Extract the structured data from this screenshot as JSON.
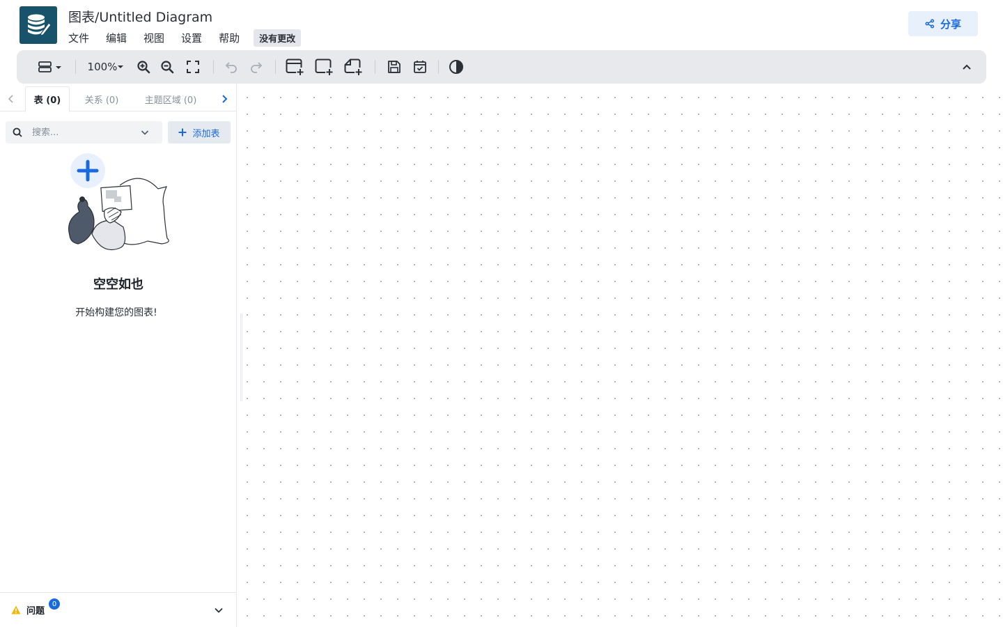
{
  "app": {
    "title": "图表/Untitled Diagram",
    "status": "没有更改",
    "share_label": "分享"
  },
  "menu": {
    "items": [
      "文件",
      "编辑",
      "视图",
      "设置",
      "帮助"
    ]
  },
  "toolbar": {
    "zoom": "100%",
    "icons": [
      "layout-icon",
      "zoom-in-icon",
      "zoom-out-icon",
      "fit-screen-icon",
      "undo-icon",
      "redo-icon",
      "add-table-icon",
      "add-area-icon",
      "add-note-icon",
      "save-icon",
      "todo-icon",
      "theme-icon",
      "collapse-icon"
    ]
  },
  "sidebar": {
    "tabs": [
      {
        "label": "表 (0)",
        "active": true
      },
      {
        "label": "关系 (0)",
        "active": false
      },
      {
        "label": "主题区域 (0)",
        "active": false
      }
    ],
    "search_placeholder": "搜索...",
    "add_table_label": "添加表",
    "empty_title": "空空如也",
    "empty_desc": "开始构建您的图表!",
    "issues_label": "问题",
    "issues_count": "0"
  },
  "colors": {
    "accent": "#1a6adf",
    "logo_bg": "#18526b",
    "toolbar_bg": "#e8e9ec",
    "warning": "#f2b706"
  }
}
